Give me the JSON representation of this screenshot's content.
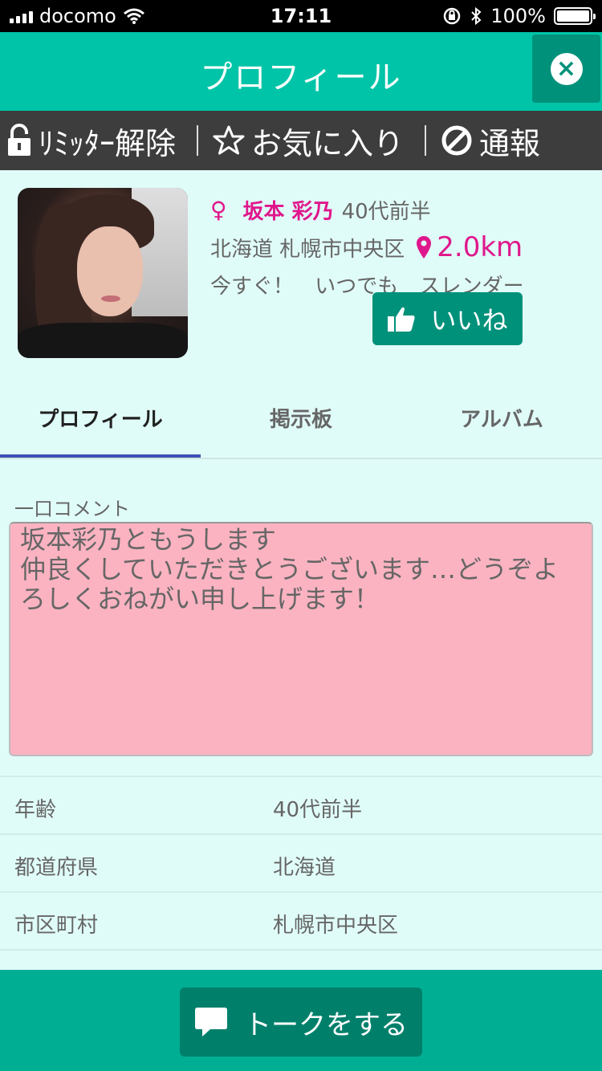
{
  "status_bar": {
    "carrier": "docomo",
    "time": "17:11",
    "battery": "100%",
    "battery_level": 1.0
  },
  "header": {
    "title": "プロフィール",
    "close_icon": "close-circle-icon"
  },
  "actions": {
    "limiter": "ﾘﾐｯﾀｰ解除",
    "favorite": "お気に入り",
    "report": "通報"
  },
  "profile": {
    "gender_symbol": "♀",
    "name": "坂本 彩乃",
    "age_group": "40代前半",
    "location": "北海道 札幌市中央区",
    "distance": "2.0km",
    "tags": [
      "今すぐ！",
      "いつでも",
      "スレンダー"
    ],
    "like_label": "いいね",
    "accent_color": "#e0178c"
  },
  "tabs": [
    {
      "label": "プロフィール",
      "active": true
    },
    {
      "label": "掲示板",
      "active": false
    },
    {
      "label": "アルバム",
      "active": false
    }
  ],
  "comment": {
    "label": "一口コメント",
    "text": "坂本彩乃ともうします\n仲良くしていただきとうございます…どうぞよろしくおねがい申し上げます！"
  },
  "details": [
    {
      "key": "年齢",
      "value": "40代前半"
    },
    {
      "key": "都道府県",
      "value": "北海道"
    },
    {
      "key": "市区町村",
      "value": "札幌市中央区"
    }
  ],
  "footer": {
    "talk_label": "トークをする"
  },
  "colors": {
    "header": "#00c4a7",
    "dark_button": "#00917b",
    "action_bar": "#3d3d3d",
    "background": "#e0fcf8",
    "comment_bg": "#fbb3c1",
    "tab_underline": "#3f51b5"
  }
}
